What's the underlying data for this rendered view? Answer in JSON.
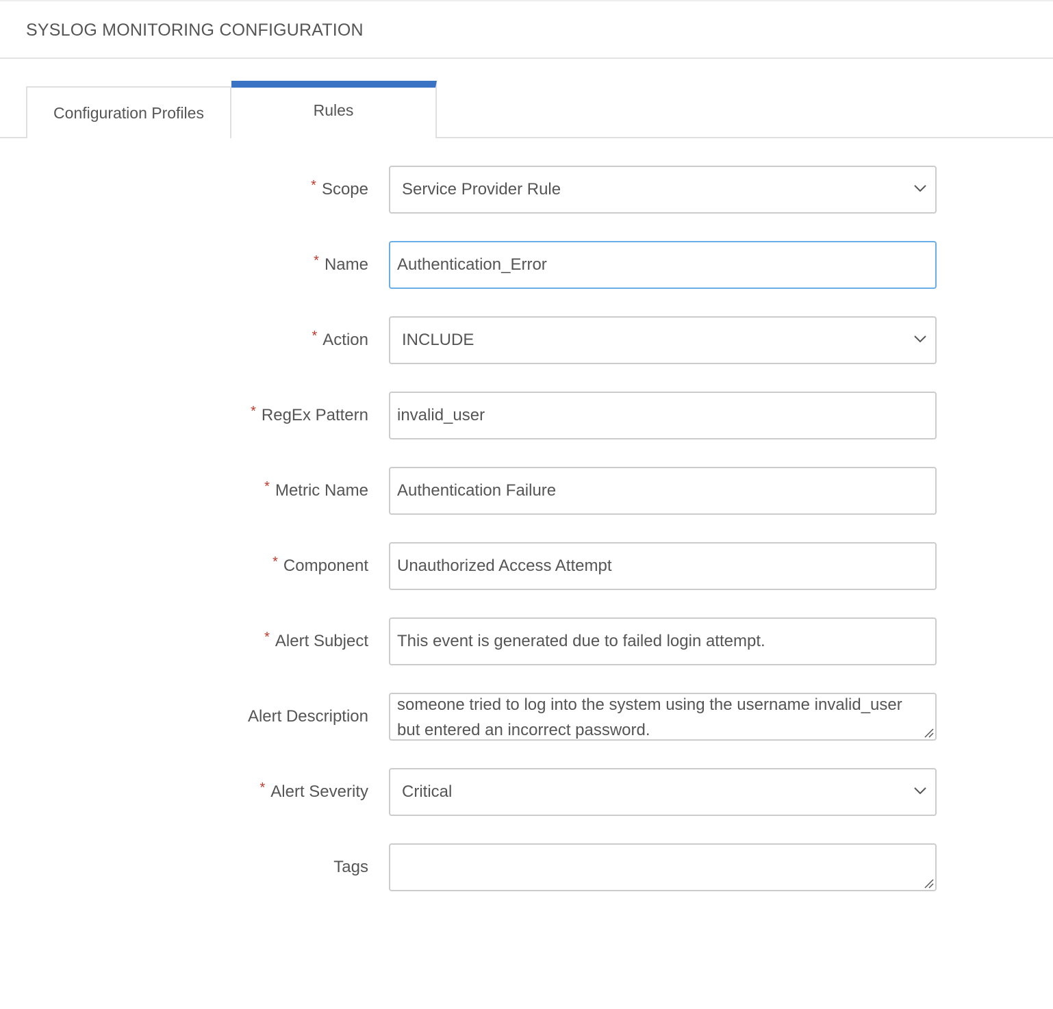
{
  "header": {
    "title": "SYSLOG MONITORING CONFIGURATION"
  },
  "tabs": [
    {
      "label": "Configuration Profiles",
      "active": false
    },
    {
      "label": "Rules",
      "active": true
    }
  ],
  "accent_color": "#3a73c4",
  "required_color": "#c0392b",
  "form": {
    "required_marker": "*",
    "scope": {
      "label": "Scope",
      "value": "Service Provider Rule",
      "icon": "chevron-down-icon"
    },
    "name": {
      "label": "Name",
      "value": "Authentication_Error"
    },
    "action": {
      "label": "Action",
      "value": "INCLUDE",
      "icon": "chevron-down-icon"
    },
    "regex": {
      "label": "RegEx Pattern",
      "value": "invalid_user"
    },
    "metric_name": {
      "label": "Metric Name",
      "value": "Authentication Failure"
    },
    "component": {
      "label": "Component",
      "value": "Unauthorized Access Attempt"
    },
    "alert_subject": {
      "label": "Alert Subject",
      "value": "This event is generated due to failed login attempt."
    },
    "alert_description": {
      "label": "Alert Description",
      "value": "someone tried to log into the system using the username invalid_user but entered an incorrect password."
    },
    "alert_severity": {
      "label": "Alert Severity",
      "value": "Critical",
      "icon": "chevron-down-icon"
    },
    "tags": {
      "label": "Tags",
      "value": ""
    }
  }
}
